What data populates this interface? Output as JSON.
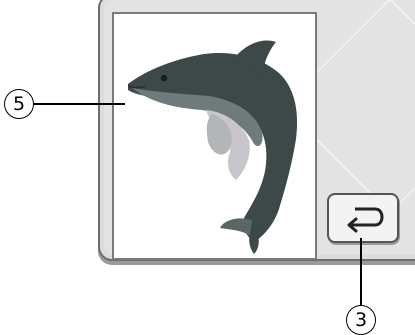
{
  "callouts": [
    {
      "label": "⑤",
      "num": "5"
    },
    {
      "label": "③",
      "num": "3"
    }
  ],
  "preview": {
    "motif": "dolphin-embroidery"
  },
  "buttons": {
    "return_icon": "return-arrow-icon"
  },
  "colors": {
    "dolphin_dark": "#3d4848",
    "dolphin_mid": "#6f7a7c",
    "dolphin_light": "#b2b6b8",
    "belly": "#c9c5cc"
  }
}
